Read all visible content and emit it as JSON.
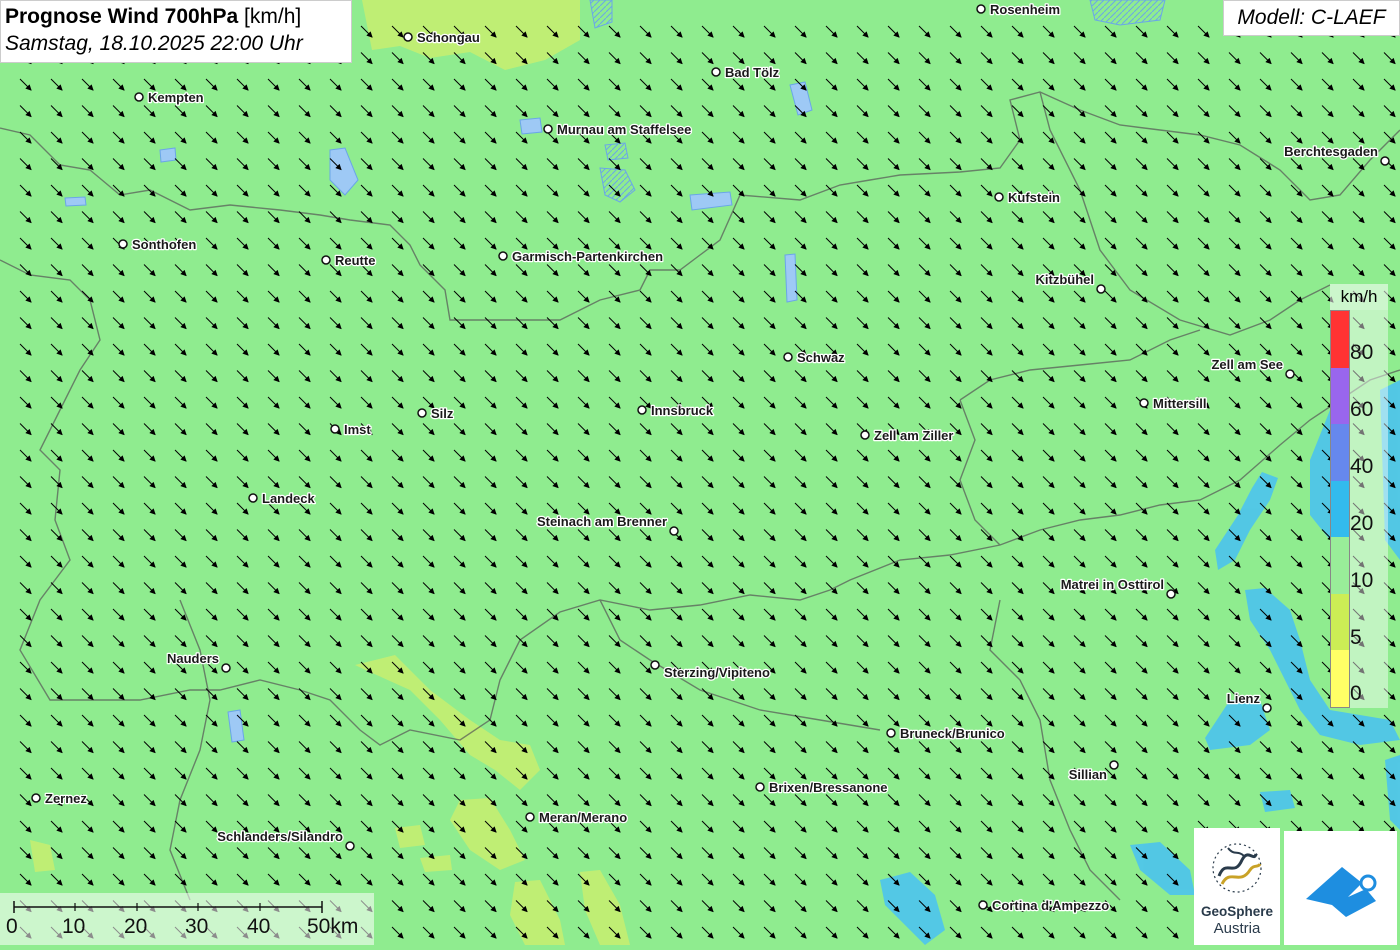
{
  "header": {
    "title_bold": "Prognose Wind 700hPa",
    "title_unit": "[km/h]",
    "datetime": "Samstag, 18.10.2025 22:00 Uhr"
  },
  "model": "Modell: C-LAEF",
  "map": {
    "background_color": "#8fec8f",
    "arrow_direction": "southeast",
    "cities": [
      {
        "name": "Rosenheim"
      },
      {
        "name": "Schongau"
      },
      {
        "name": "Bad Tölz"
      },
      {
        "name": "Kempten"
      },
      {
        "name": "Murnau am Staffelsee"
      },
      {
        "name": "Berchtesgaden"
      },
      {
        "name": "Kufstein"
      },
      {
        "name": "Sonthofen"
      },
      {
        "name": "Reutte"
      },
      {
        "name": "Garmisch-Partenkirchen"
      },
      {
        "name": "Kitzbühel"
      },
      {
        "name": "Schwaz"
      },
      {
        "name": "Zell am See"
      },
      {
        "name": "Mittersill"
      },
      {
        "name": "Silz"
      },
      {
        "name": "Innsbruck"
      },
      {
        "name": "Imst"
      },
      {
        "name": "Zell am Ziller"
      },
      {
        "name": "Landeck"
      },
      {
        "name": "Steinach am Brenner"
      },
      {
        "name": "Matrei in Osttirol"
      },
      {
        "name": "Nauders"
      },
      {
        "name": "Sterzing/Vipiteno"
      },
      {
        "name": "Lienz"
      },
      {
        "name": "Bruneck/Brunico"
      },
      {
        "name": "Sillian"
      },
      {
        "name": "Brixen/Bressanone"
      },
      {
        "name": "Zernez"
      },
      {
        "name": "Meran/Merano"
      },
      {
        "name": "Schlanders/Silandro"
      },
      {
        "name": "Cortina d'Ampezzo"
      }
    ]
  },
  "legend": {
    "unit": "km/h",
    "labels": [
      "80",
      "60",
      "40",
      "20",
      "10",
      "5",
      "0"
    ],
    "colors": [
      "#ff3333",
      "#9966ee",
      "#6688ee",
      "#33bbee",
      "#99ee99",
      "#ccee55",
      "#ffff66"
    ]
  },
  "scalebar": {
    "labels": [
      "0",
      "10",
      "20",
      "30",
      "40",
      "50km"
    ]
  },
  "logos": {
    "geosphere_name": "GeoSphere",
    "geosphere_sub": "Austria"
  }
}
